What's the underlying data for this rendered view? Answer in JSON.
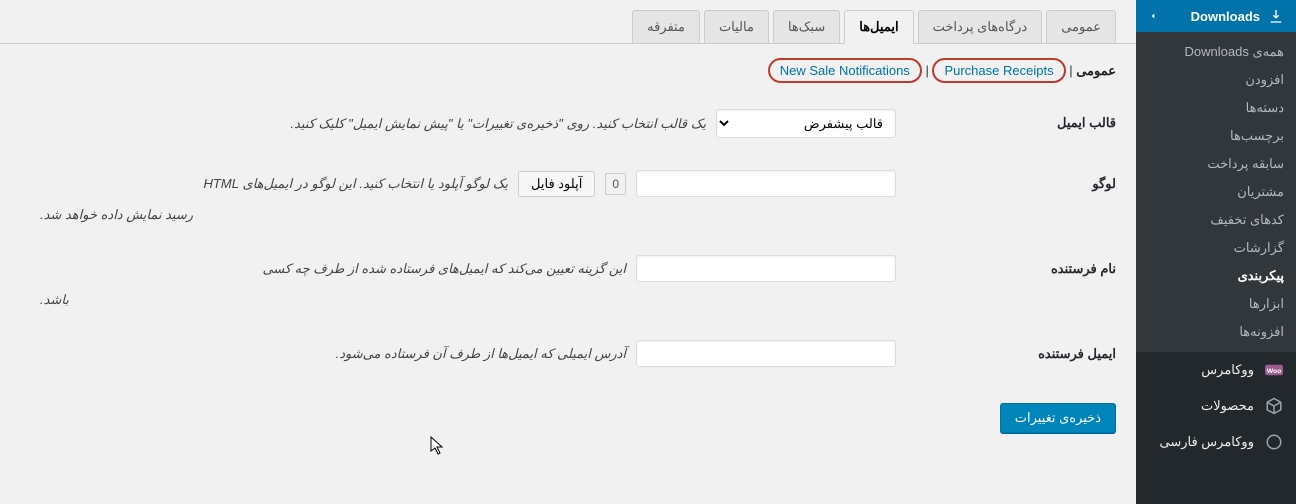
{
  "sidebar": {
    "header": "Downloads",
    "submenu": [
      {
        "label": "همه‌ی Downloads",
        "active": false
      },
      {
        "label": "افزودن",
        "active": false
      },
      {
        "label": "دسته‌ها",
        "active": false
      },
      {
        "label": "برچسب‌ها",
        "active": false
      },
      {
        "label": "سابقه پرداخت",
        "active": false
      },
      {
        "label": "مشتریان",
        "active": false
      },
      {
        "label": "کدهای تخفیف",
        "active": false
      },
      {
        "label": "گزارشات",
        "active": false
      },
      {
        "label": "پیکربندی",
        "active": true
      },
      {
        "label": "ابزارها",
        "active": false
      },
      {
        "label": "افزونه‌ها",
        "active": false
      }
    ],
    "main_menu": [
      {
        "label": "ووکامرس",
        "icon": "woo"
      },
      {
        "label": "محصولات",
        "icon": "package"
      },
      {
        "label": "ووکامرس فارسی",
        "icon": "woo2"
      }
    ]
  },
  "tabs": [
    {
      "label": "عمومی",
      "active": false
    },
    {
      "label": "درگاه‌های پرداخت",
      "active": false
    },
    {
      "label": "ایمیل‌ها",
      "active": true
    },
    {
      "label": "سبک‌ها",
      "active": false
    },
    {
      "label": "مالیات",
      "active": false
    },
    {
      "label": "متفرقه",
      "active": false
    }
  ],
  "subsection": {
    "general": "عمومی",
    "link1": "Purchase Receipts",
    "sep": "|",
    "link2": "New Sale Notifications"
  },
  "form": {
    "template": {
      "label": "قالب ایمیل",
      "selected": "قالب پیشفرض",
      "desc": "یک قالب انتخاب کنید. روی \"ذخیره‌ی تغییرات\" یا \"پیش نمایش ایمیل\" کلیک کنید."
    },
    "logo": {
      "label": "لوگو",
      "upload_btn": "آپلود فایل",
      "file_count": "0",
      "desc": "یک لوگو آپلود یا انتخاب کنید. این لوگو در ایمیل‌های HTML",
      "desc2": "رسید نمایش داده خواهد شد."
    },
    "from_name": {
      "label": "نام فرستنده",
      "value": "",
      "desc": "این گزینه تعیین می‌کند که ایمیل‌های فرستاده شده از طرف چه کسی",
      "desc2": "باشد."
    },
    "from_email": {
      "label": "ایمیل فرستنده",
      "value": "",
      "desc": "آدرس ایمیلی که ایمیل‌ها از طرف آن فرستاده می‌شود."
    },
    "save": "ذخیره‌ی تغییرات"
  }
}
